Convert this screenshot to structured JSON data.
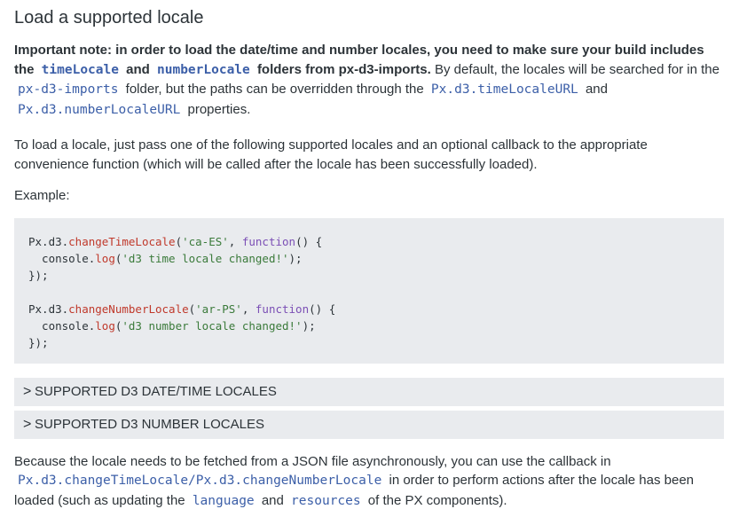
{
  "heading": "Load a supported locale",
  "note": {
    "bold_prefix": "Important note: in order to load the date/time and number locales, you need to make sure your build includes the",
    "code_time_locale": "timeLocale",
    "bold_and": "and",
    "code_number_locale": "numberLocale",
    "bold_suffix": "folders from px-d3-imports.",
    "text_1": "By default, the locales will be searched for in the",
    "code_imports": "px-d3-imports",
    "text_2": "folder, but the paths can be overridden through the",
    "code_time_url": "Px.d3.timeLocaleURL",
    "text_3": "and",
    "code_number_url": "Px.d3.numberLocaleURL",
    "text_4": "properties."
  },
  "intro": "To load a locale, just pass one of the following supported locales and an optional callback to the appropriate convenience function (which will be called after the locale has been successfully loaded).",
  "example_label": "Example:",
  "code": {
    "l1_obj": "Px.d3.",
    "l1_fn": "changeTimeLocale",
    "l1_open": "(",
    "l1_str": "'ca-ES'",
    "l1_sep": ", ",
    "l1_kw": "function",
    "l1_end": "() {",
    "l2_obj": "  console.",
    "l2_fn": "log",
    "l2_open": "(",
    "l2_str": "'d3 time locale changed!'",
    "l2_end": ");",
    "l3": "});",
    "l5_obj": "Px.d3.",
    "l5_fn": "changeNumberLocale",
    "l5_open": "(",
    "l5_str": "'ar-PS'",
    "l5_sep": ", ",
    "l5_kw": "function",
    "l5_end": "() {",
    "l6_obj": "  console.",
    "l6_fn": "log",
    "l6_open": "(",
    "l6_str": "'d3 number locale changed!'",
    "l6_end": ");",
    "l7": "});"
  },
  "accordions": [
    {
      "label": "SUPPORTED D3 DATE/TIME LOCALES",
      "chevron": ">"
    },
    {
      "label": "SUPPORTED D3 NUMBER LOCALES",
      "chevron": ">"
    }
  ],
  "closing": {
    "text_1": "Because the locale needs to be fetched from a JSON file asynchronously, you can use the callback in",
    "code_fns": "Px.d3.changeTimeLocale/Px.d3.changeNumberLocale",
    "text_2": "in order to perform actions after the locale has been loaded (such as updating the",
    "code_language": "language",
    "text_3": "and",
    "code_resources": "resources",
    "text_4": "of the PX components)."
  }
}
